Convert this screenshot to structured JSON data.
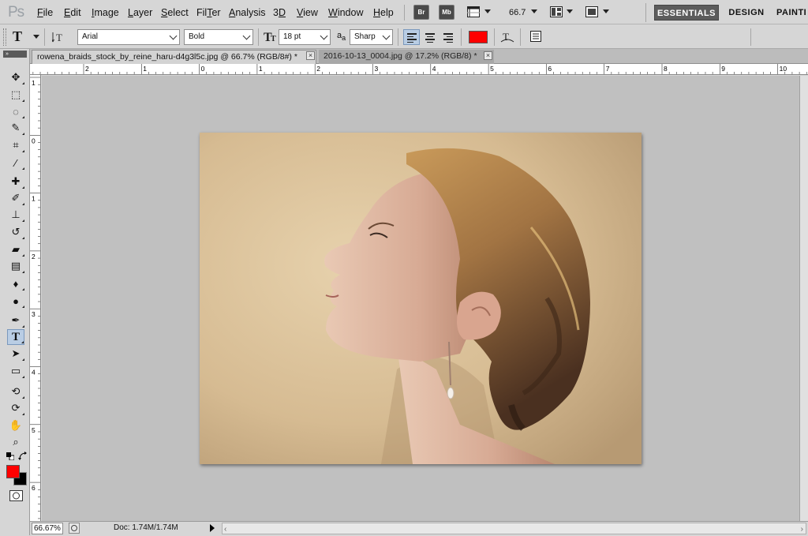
{
  "app": {
    "logo": "Ps"
  },
  "menu": [
    "File",
    "Edit",
    "Image",
    "Layer",
    "Select",
    "Filter",
    "Analysis",
    "3D",
    "View",
    "Window",
    "Help"
  ],
  "menu_mnemonics": [
    "F",
    "E",
    "I",
    "L",
    "S",
    "T",
    "A",
    "D",
    "V",
    "W",
    "H"
  ],
  "bridge": {
    "br_label": "Br",
    "mb_label": "Mb"
  },
  "zoom_dropdown": "66.7",
  "workspaces": {
    "essentials": "ESSENTIALS",
    "design": "DESIGN",
    "painting": "PAINTI"
  },
  "options": {
    "tool_icon": "type-tool-icon",
    "font_family": "Arial",
    "font_style": "Bold",
    "font_size": "18 pt",
    "antialias": "Sharp",
    "text_color": "#ff0000",
    "alignment": "left"
  },
  "tabs": [
    {
      "title": "rowena_braids_stock_by_reine_haru-d4g3l5c.jpg @ 66.7% (RGB/8#) *",
      "active": true
    },
    {
      "title": "2016-10-13_0004.jpg @ 17.2% (RGB/8) *",
      "active": false
    }
  ],
  "ruler_h_labels": [
    "2",
    "1",
    "0",
    "1",
    "2",
    "3",
    "4",
    "5",
    "6",
    "7",
    "8",
    "9",
    "10"
  ],
  "ruler_v_labels": [
    "1",
    "0",
    "1",
    "2",
    "3",
    "4",
    "5",
    "6"
  ],
  "tools": [
    "move-tool-icon",
    "marquee-tool-icon",
    "lasso-tool-icon",
    "quick-select-tool-icon",
    "crop-tool-icon",
    "eyedropper-tool-icon",
    "healing-brush-tool-icon",
    "brush-tool-icon",
    "clone-stamp-tool-icon",
    "history-brush-tool-icon",
    "eraser-tool-icon",
    "gradient-tool-icon",
    "blur-tool-icon",
    "dodge-tool-icon",
    "pen-tool-icon",
    "type-tool-icon",
    "path-selection-tool-icon",
    "rectangle-tool-icon",
    "3d-rotate-tool-icon",
    "3d-orbit-tool-icon",
    "hand-tool-icon",
    "zoom-tool-icon"
  ],
  "colors": {
    "foreground": "#ff0000",
    "background": "#000000",
    "canvas_bg": "#c0c0c0"
  },
  "status": {
    "zoom": "66.67%",
    "doc_size": "Doc: 1.74M/1.74M"
  }
}
